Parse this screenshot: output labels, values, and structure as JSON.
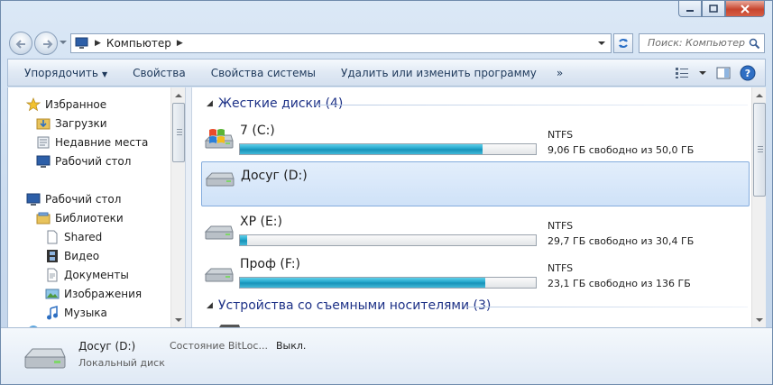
{
  "address": {
    "location": "Компьютер",
    "search_placeholder": "Поиск: Компьютер"
  },
  "icons": {
    "back": "back-arrow-icon",
    "forward": "forward-arrow-icon",
    "refresh": "refresh-icon",
    "search": "search-icon",
    "help": "help-icon"
  },
  "toolbar": {
    "organize": "Упорядочить",
    "properties": "Свойства",
    "system_properties": "Свойства системы",
    "uninstall": "Удалить или изменить программу",
    "more": "»"
  },
  "nav": {
    "favorites": "Избранное",
    "downloads": "Загрузки",
    "recent": "Недавние места",
    "desktop_fav": "Рабочий стол",
    "desktop": "Рабочий стол",
    "libraries": "Библиотеки",
    "shared": "Shared",
    "video": "Видео",
    "documents": "Документы",
    "images": "Изображения",
    "music": "Музыка"
  },
  "groups": {
    "hard_disks": "Жесткие диски (4)",
    "removable": "Устройства со съемными носителями (3)"
  },
  "drives": [
    {
      "name": "7 (C:)",
      "fs": "NTFS",
      "free": "9,06 ГБ свободно из 50,0 ГБ",
      "used_fraction": 0.82,
      "selected": false
    },
    {
      "name": "Досуг (D:)",
      "fs": "",
      "free": "",
      "used_fraction": null,
      "selected": true
    },
    {
      "name": "XP (E:)",
      "fs": "NTFS",
      "free": "29,7 ГБ свободно из 30,4 ГБ",
      "used_fraction": 0.023,
      "selected": false
    },
    {
      "name": "Проф (F:)",
      "fs": "NTFS",
      "free": "23,1 ГБ свободно из 136 ГБ",
      "used_fraction": 0.83,
      "selected": false
    }
  ],
  "details": {
    "name": "Досуг (D:)",
    "type": "Локальный диск",
    "label": "Состояние BitLoc...",
    "value": "Выкл."
  },
  "colors": {
    "bar_fill": "#1b9fc6",
    "group_header": "#1e3287",
    "selection": "#cfe2f8"
  }
}
